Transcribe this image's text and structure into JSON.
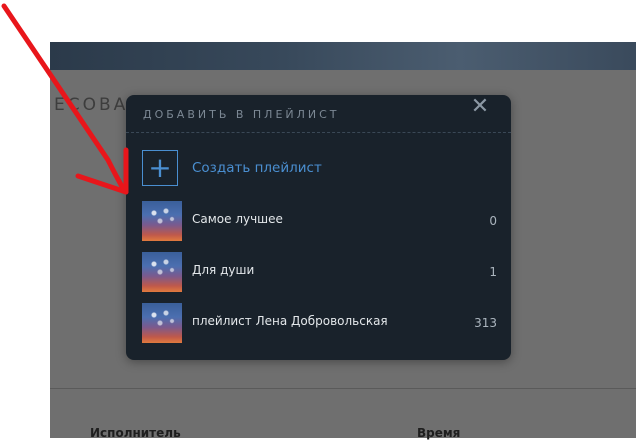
{
  "background": {
    "heading": "ЕСОВА",
    "columns": {
      "artist": "Исполнитель",
      "time": "Время"
    }
  },
  "modal": {
    "title": "ДОБАВИТЬ В ПЛЕЙЛИСТ",
    "close_icon": "close-icon",
    "create": {
      "icon": "plus-icon",
      "label": "Создать плейлист"
    },
    "playlists": [
      {
        "name": "Самое лучшее",
        "count": "0"
      },
      {
        "name": "Для души",
        "count": "1"
      },
      {
        "name": "плейлист Лена Добровольская",
        "count": "313"
      }
    ]
  },
  "colors": {
    "modal_bg": "#19222b",
    "accent": "#4a8fd1",
    "arrow": "#e8161b"
  }
}
